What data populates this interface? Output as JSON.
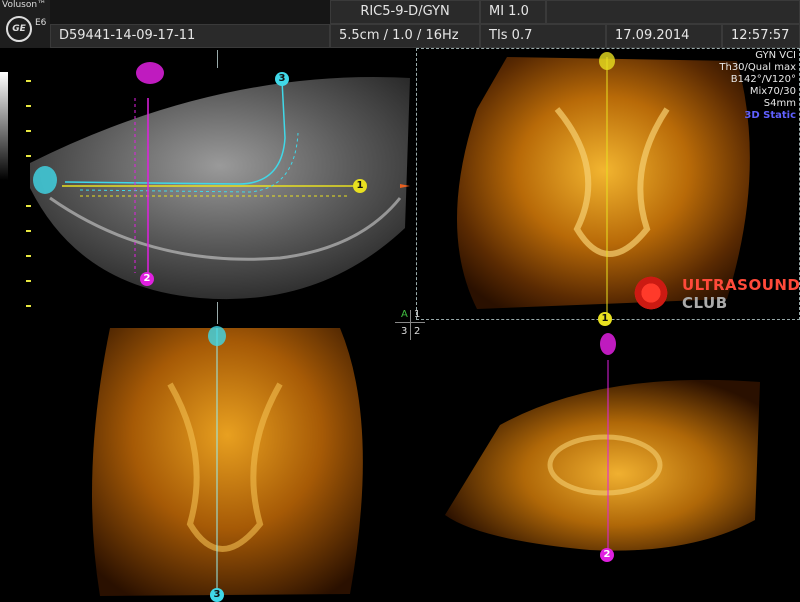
{
  "header": {
    "brand": "Voluson™",
    "model": "E6",
    "ge_logo": "GE",
    "patient_id": "D59441-14-09-17-11",
    "probe": "RIC5-9-D/GYN",
    "mi": "MI  1.0",
    "depth_freq": "5.5cm / 1.0 / 16Hz",
    "tis": "TIs  0.7",
    "date": "17.09.2014",
    "time": "12:57:57"
  },
  "settings": {
    "lines": [
      "GYN VCI",
      "Th30/Qual max",
      "B142°/V120°",
      "Mix70/30",
      "S4mm",
      "3D Static"
    ],
    "highlight_color": "#6060ff"
  },
  "markers": {
    "m1": "1",
    "m2": "2",
    "m3": "3"
  },
  "grid_labels": {
    "a": "A",
    "one": "1",
    "three": "3",
    "two": "2"
  },
  "watermark": {
    "line1": "ULTRASOUND",
    "line2": "CLUB"
  },
  "colors": {
    "marker1": "#e8e020",
    "marker2": "#e020e0",
    "marker3": "#40d8e8",
    "render_orange": "#d88a10"
  }
}
